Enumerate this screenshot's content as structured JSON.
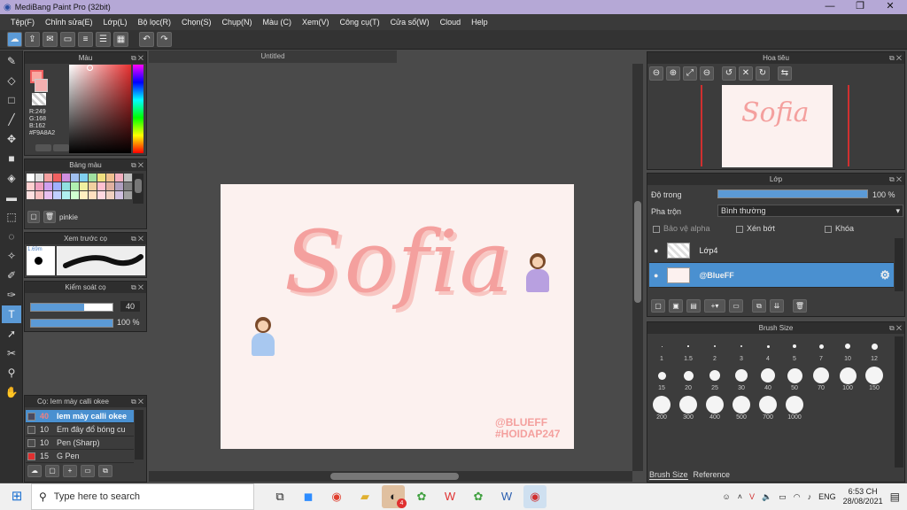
{
  "app": {
    "title": "MediBang Paint Pro (32bit)"
  },
  "window_controls": {
    "minimize": "—",
    "maximize": "❐",
    "close": "✕"
  },
  "menu": [
    "Tệp(F)",
    "Chỉnh sửa(E)",
    "Lớp(L)",
    "Bộ lọc(R)",
    "Chọn(S)",
    "Chụp(N)",
    "Màu (C)",
    "Xem(V)",
    "Công cụ(T)",
    "Cửa sổ(W)",
    "Cloud",
    "Help"
  ],
  "color_panel": {
    "title": "Màu",
    "r": "R:249",
    "g": "G:168",
    "b": "B:162",
    "hex": "#F9A8A2",
    "primary": "#F9A8A2"
  },
  "swatch_panel": {
    "title": "Bảng màu",
    "palette_name": "pinkie",
    "colors": [
      "#ffffff",
      "#e0e0e0",
      "#f4a0a0",
      "#f06060",
      "#d08fe0",
      "#a0c0f0",
      "#80d0f0",
      "#a0e0a0",
      "#f0e080",
      "#f0c090",
      "#f4b0c0",
      "#c0c0c0",
      "#ffd0d0",
      "#f0a0c0",
      "#d0a0f0",
      "#a0b0ff",
      "#90e0e0",
      "#b0f0b0",
      "#f0f0a0",
      "#f0d0a0",
      "#ffc0d0",
      "#e0b0a0",
      "#b0a0c0",
      "#808080",
      "#ffe0e0",
      "#f8c0c0",
      "#e8c0f0",
      "#c0d0ff",
      "#b0f0f0",
      "#d0ffd0",
      "#fff0c0",
      "#ffe0c0",
      "#ffd8e0",
      "#f0d0c0",
      "#d0c0e0",
      "#a0a0a0"
    ]
  },
  "brush_preview": {
    "title": "Xem trước cọ",
    "size": "1.69m"
  },
  "brush_control": {
    "title": "Kiểm soát cọ",
    "size_value": "40",
    "opacity_value": "100 %"
  },
  "brush_list": {
    "title": "Cọ: Iem mày calli okee",
    "items": [
      {
        "size": "40",
        "name": "Iem mày calli okee",
        "color": "#4a4a60",
        "active": true
      },
      {
        "size": "10",
        "name": "Em đây đổ bóng cu",
        "color": "#4a4a4a",
        "active": false
      },
      {
        "size": "10",
        "name": "Pen (Sharp)",
        "color": "#4a4a4a",
        "active": false
      },
      {
        "size": "15",
        "name": "G Pen",
        "color": "#e03030",
        "active": false
      }
    ]
  },
  "document": {
    "tab": "Untitled",
    "word": "Sofia",
    "watermark1": "@BLUEFF",
    "watermark2": "#HOIDAP247"
  },
  "navigator": {
    "title": "Hoa tiêu",
    "word": "Sofia"
  },
  "layer_panel": {
    "title": "Lớp",
    "opacity_label": "Độ trong",
    "opacity_value": "100 %",
    "blend_label": "Pha trộn",
    "blend_value": "Bình thường",
    "protect_alpha": "Bảo vệ alpha",
    "clip": "Xén bớt",
    "lock": "Khóa",
    "layers": [
      {
        "name": "Lớp4",
        "active": false
      },
      {
        "name": "@BlueFF",
        "active": true
      }
    ]
  },
  "brush_size_panel": {
    "title": "Brush Size",
    "sizes": [
      "1",
      "1.5",
      "2",
      "3",
      "4",
      "5",
      "7",
      "10",
      "12",
      "15",
      "20",
      "25",
      "30",
      "40",
      "50",
      "70",
      "100",
      "150",
      "200",
      "300",
      "400",
      "500",
      "700",
      "1000"
    ],
    "tabs": [
      "Brush Size",
      "Reference"
    ]
  },
  "taskbar": {
    "search_placeholder": "Type here to search",
    "time": "6:53 CH",
    "date": "28/08/2021",
    "lang": "ENG",
    "badge": "4"
  }
}
